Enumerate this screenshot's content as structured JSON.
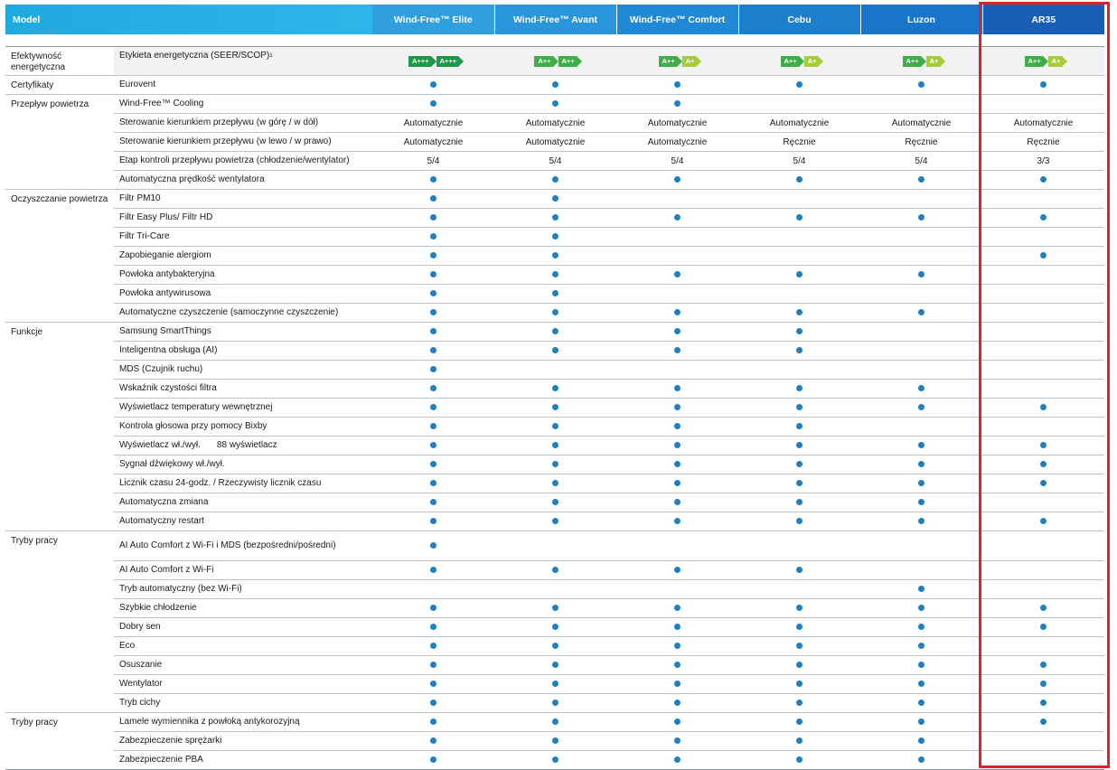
{
  "header": {
    "model_label": "Model",
    "models": [
      "Wind-Free™ Elite",
      "Wind-Free™ Avant",
      "Wind-Free™ Comfort",
      "Cebu",
      "Luzon",
      "AR35"
    ]
  },
  "energy": {
    "category": "Efektywność energetyczna",
    "label": "Etykieta energetyczna (SEER/SCOP)",
    "footnote": "1",
    "ratings": [
      [
        {
          "text": "A+++",
          "color": "#1c9a49"
        },
        {
          "text": "A+++",
          "color": "#1c9a49"
        }
      ],
      [
        {
          "text": "A++",
          "color": "#3fae48"
        },
        {
          "text": "A++",
          "color": "#3fae48"
        }
      ],
      [
        {
          "text": "A++",
          "color": "#3fae48"
        },
        {
          "text": "A+",
          "color": "#a6cc39"
        }
      ],
      [
        {
          "text": "A++",
          "color": "#3fae48"
        },
        {
          "text": "A+",
          "color": "#a6cc39"
        }
      ],
      [
        {
          "text": "A++",
          "color": "#3fae48"
        },
        {
          "text": "A+",
          "color": "#a6cc39"
        }
      ],
      [
        {
          "text": "A++",
          "color": "#3fae48"
        },
        {
          "text": "A+",
          "color": "#a6cc39"
        }
      ]
    ]
  },
  "rows": [
    {
      "category": "Certyfikaty",
      "feature": "Eurovent",
      "values": [
        1,
        1,
        1,
        1,
        1,
        1
      ]
    },
    {
      "category": "Przepływ powietrza",
      "feature": "Wind-Free™ Cooling",
      "values": [
        1,
        1,
        1,
        0,
        0,
        0
      ]
    },
    {
      "category": "",
      "feature": "Sterowanie kierunkiem przepływu (w górę / w dół)",
      "values": [
        "Automatycznie",
        "Automatycznie",
        "Automatycznie",
        "Automatycznie",
        "Automatycznie",
        "Automatycznie"
      ]
    },
    {
      "category": "",
      "feature": "Sterowanie kierunkiem przepływu (w lewo / w prawo)",
      "values": [
        "Automatycznie",
        "Automatycznie",
        "Automatycznie",
        "Ręcznie",
        "Ręcznie",
        "Ręcznie"
      ]
    },
    {
      "category": "",
      "feature": "Etap kontroli przepływu powietrza (chłodzenie/wentylator)",
      "values": [
        "5/4",
        "5/4",
        "5/4",
        "5/4",
        "5/4",
        "3/3"
      ]
    },
    {
      "category": "",
      "feature": "Automatyczna prędkość wentylatora",
      "values": [
        1,
        1,
        1,
        1,
        1,
        1
      ]
    },
    {
      "category": "Oczyszczanie powietrza",
      "feature": "Filtr PM10",
      "values": [
        1,
        1,
        0,
        0,
        0,
        0
      ]
    },
    {
      "category": "",
      "feature": "Filtr Easy Plus/ Filtr HD",
      "values": [
        1,
        1,
        1,
        1,
        1,
        1
      ]
    },
    {
      "category": "",
      "feature": "Filtr Tri-Care",
      "values": [
        1,
        1,
        0,
        0,
        0,
        0
      ]
    },
    {
      "category": "",
      "feature": "Zapobieganie alergiom",
      "values": [
        1,
        1,
        0,
        0,
        0,
        1
      ]
    },
    {
      "category": "",
      "feature": "Powłoka antybakteryjna",
      "values": [
        1,
        1,
        1,
        1,
        1,
        0
      ]
    },
    {
      "category": "",
      "feature": "Powłoka antywirusowa",
      "values": [
        1,
        1,
        0,
        0,
        0,
        0
      ]
    },
    {
      "category": "",
      "feature": "Automatyczne czyszczenie (samoczynne czyszczenie)",
      "values": [
        1,
        1,
        1,
        1,
        1,
        0
      ]
    },
    {
      "category": "Funkcje",
      "feature": "Samsung SmartThings",
      "values": [
        1,
        1,
        1,
        1,
        0,
        0
      ]
    },
    {
      "category": "",
      "feature": "Inteligentna obsługa (AI)",
      "values": [
        1,
        1,
        1,
        1,
        0,
        0
      ]
    },
    {
      "category": "",
      "feature": "MDS (Czujnik ruchu)",
      "values": [
        1,
        0,
        0,
        0,
        0,
        0
      ]
    },
    {
      "category": "",
      "feature": "Wskaźnik czystości filtra",
      "values": [
        1,
        1,
        1,
        1,
        1,
        0
      ]
    },
    {
      "category": "",
      "feature": "Wyświetlacz temperatury wewnętrznej",
      "values": [
        1,
        1,
        1,
        1,
        1,
        1
      ]
    },
    {
      "category": "",
      "feature": "Kontrola głosowa przy pomocy Bixby",
      "values": [
        1,
        1,
        1,
        1,
        0,
        0
      ]
    },
    {
      "category": "",
      "feature": "Wyświetlacz wł./wył.",
      "feature_extra": "88 wyświetlacz",
      "values": [
        1,
        1,
        1,
        1,
        1,
        1
      ]
    },
    {
      "category": "",
      "feature": "Sygnał dźwiękowy wł./wył.",
      "values": [
        1,
        1,
        1,
        1,
        1,
        1
      ]
    },
    {
      "category": "",
      "feature": "Licznik czasu 24-godz. / Rzeczywisty licznik czasu",
      "values": [
        1,
        1,
        1,
        1,
        1,
        1
      ]
    },
    {
      "category": "",
      "feature": "Automatyczna zmiana",
      "values": [
        1,
        1,
        1,
        1,
        1,
        0
      ]
    },
    {
      "category": "",
      "feature": "Automatyczny restart",
      "values": [
        1,
        1,
        1,
        1,
        1,
        1
      ]
    },
    {
      "category": "Tryby pracy",
      "feature": "AI Auto Comfort z Wi-Fi i MDS (bezpośredni/pośredni)",
      "values": [
        1,
        0,
        0,
        0,
        0,
        0
      ]
    },
    {
      "category": "",
      "feature": "AI Auto Comfort z Wi-Fi",
      "values": [
        1,
        1,
        1,
        1,
        0,
        0
      ]
    },
    {
      "category": "",
      "feature": "Tryb automatyczny (bez Wi-Fi)",
      "values": [
        0,
        0,
        0,
        0,
        1,
        0
      ]
    },
    {
      "category": "",
      "feature": "Szybkie chłodzenie",
      "values": [
        1,
        1,
        1,
        1,
        1,
        1
      ]
    },
    {
      "category": "",
      "feature": "Dobry sen",
      "values": [
        1,
        1,
        1,
        1,
        1,
        1
      ]
    },
    {
      "category": "",
      "feature": "Eco",
      "values": [
        1,
        1,
        1,
        1,
        1,
        0
      ]
    },
    {
      "category": "",
      "feature": "Osuszanie",
      "values": [
        1,
        1,
        1,
        1,
        1,
        1
      ]
    },
    {
      "category": "",
      "feature": "Wentylator",
      "values": [
        1,
        1,
        1,
        1,
        1,
        1
      ]
    },
    {
      "category": "",
      "feature": "Tryb cichy",
      "values": [
        1,
        1,
        1,
        1,
        1,
        1
      ]
    },
    {
      "category": "Tryby pracy",
      "feature": "Lamele wymiennika z powłoką antykorozyjną",
      "values": [
        1,
        1,
        1,
        1,
        1,
        1
      ]
    },
    {
      "category": "",
      "feature": "Zabezpieczenie sprężarki",
      "values": [
        1,
        1,
        1,
        1,
        1,
        0
      ]
    },
    {
      "category": "",
      "feature": "Zabezpieczenie PBA",
      "values": [
        1,
        1,
        1,
        1,
        1,
        0
      ]
    }
  ],
  "highlight": {
    "model": "AR35",
    "color": "#e0202a"
  }
}
